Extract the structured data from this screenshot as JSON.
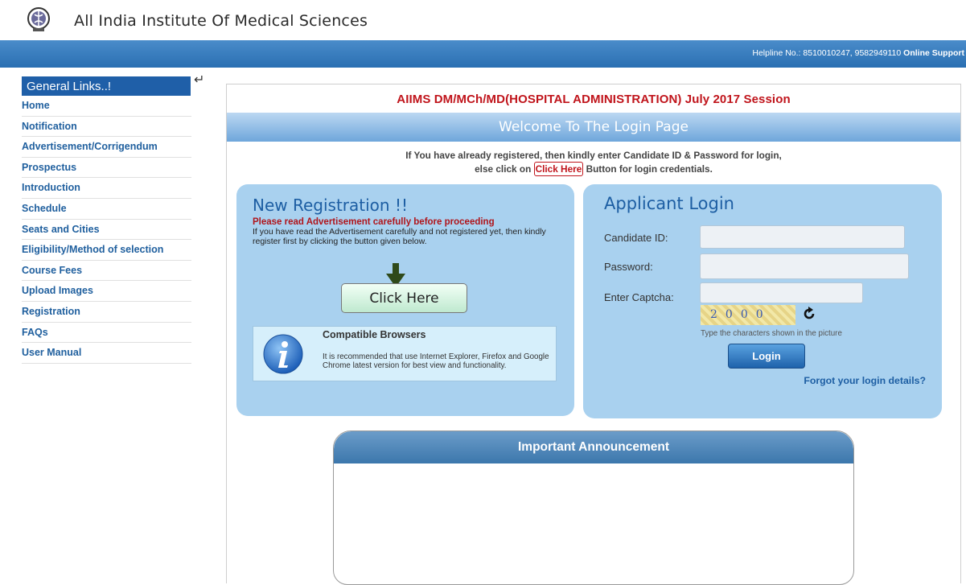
{
  "header": {
    "logo_icon": "aiims-emblem-icon",
    "title": "All India Institute Of Medical Sciences",
    "helpline_text": "Helpline No.: 8510010247, 9582949110",
    "online_support": "Online Support"
  },
  "sidebar": {
    "heading": "General Links..!",
    "items": [
      {
        "label": "Home"
      },
      {
        "label": "Notification"
      },
      {
        "label": "Advertisement/Corrigendum"
      },
      {
        "label": "Prospectus"
      },
      {
        "label": "Introduction"
      },
      {
        "label": "Schedule"
      },
      {
        "label": "Seats and Cities"
      },
      {
        "label": "Eligibility/Method of selection"
      },
      {
        "label": "Course Fees"
      },
      {
        "label": "Upload Images"
      },
      {
        "label": "Registration"
      },
      {
        "label": "FAQs"
      },
      {
        "label": "User Manual"
      }
    ]
  },
  "main": {
    "session_title": "AIIMS DM/MCh/MD(HOSPITAL ADMINISTRATION) July 2017 Session",
    "welcome": "Welcome To The Login Page",
    "info_line1": "If You have already registered, then kindly enter Candidate ID & Password for login,",
    "info_line2_pre": "else click on",
    "info_click_here": "Click Here",
    "info_line2_post": "Button for login credentials."
  },
  "registration": {
    "title": "New Registration !!",
    "warning": "Please read Advertisement carefully before proceeding",
    "text": "If you have read the Advertisement carefully and not registered yet, then kindly register first by clicking the button given below.",
    "button_label": "Click Here",
    "browsers_title": "Compatible Browsers",
    "browsers_text": "It is recommended that use Internet Explorer, Firefox and Google Chrome latest version for best view and functionality."
  },
  "login": {
    "title": "Applicant Login",
    "candidate_label": "Candidate ID:",
    "candidate_value": "",
    "password_label": "Password:",
    "password_value": "",
    "captcha_label": "Enter Captcha:",
    "captcha_value": "",
    "captcha_text": "2000",
    "captcha_hint": "Type the characters shown in the picture",
    "login_button": "Login",
    "forgot": "Forgot your login details?"
  },
  "announcement": {
    "title": "Important Announcement"
  },
  "colors": {
    "accent_blue": "#1f5fa8",
    "panel_blue": "#a9d1ef",
    "warning_red": "#c0141b"
  }
}
